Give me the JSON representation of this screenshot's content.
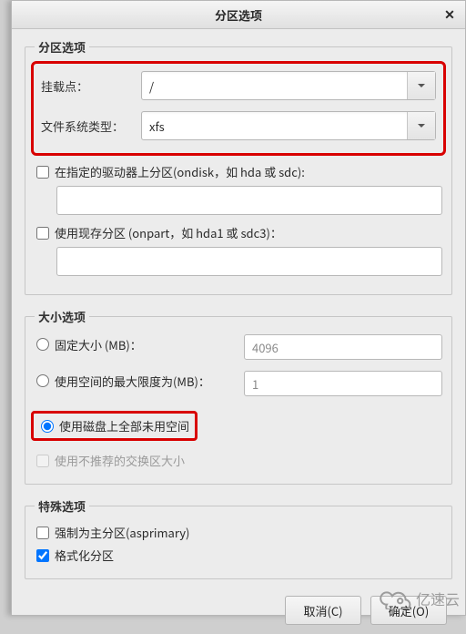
{
  "window": {
    "title": "分区选项"
  },
  "groups": {
    "partition": "分区选项",
    "size": "大小选项",
    "special": "特殊选项"
  },
  "partition": {
    "mount_label": "挂载点：",
    "mount_value": "/",
    "fstype_label": "文件系统类型：",
    "fstype_value": "xfs",
    "ondisk_label": "在指定的驱动器上分区(ondisk，如 hda 或 sdc):",
    "onpart_label": "使用现存分区 (onpart，如 hda1 或 sdc3)："
  },
  "size": {
    "fixed_label": "固定大小 (MB)：",
    "fixed_value": "4096",
    "max_label": "使用空间的最大限度为(MB)：",
    "max_value": "1",
    "fill_label": "使用磁盘上全部未用空间",
    "swap_label": "使用不推荐的交换区大小"
  },
  "special": {
    "asprimary_label": "强制为主分区(asprimary)",
    "format_label": "格式化分区"
  },
  "footer": {
    "cancel": "取消(C)",
    "ok": "确定(O)"
  },
  "watermark": "亿速云"
}
